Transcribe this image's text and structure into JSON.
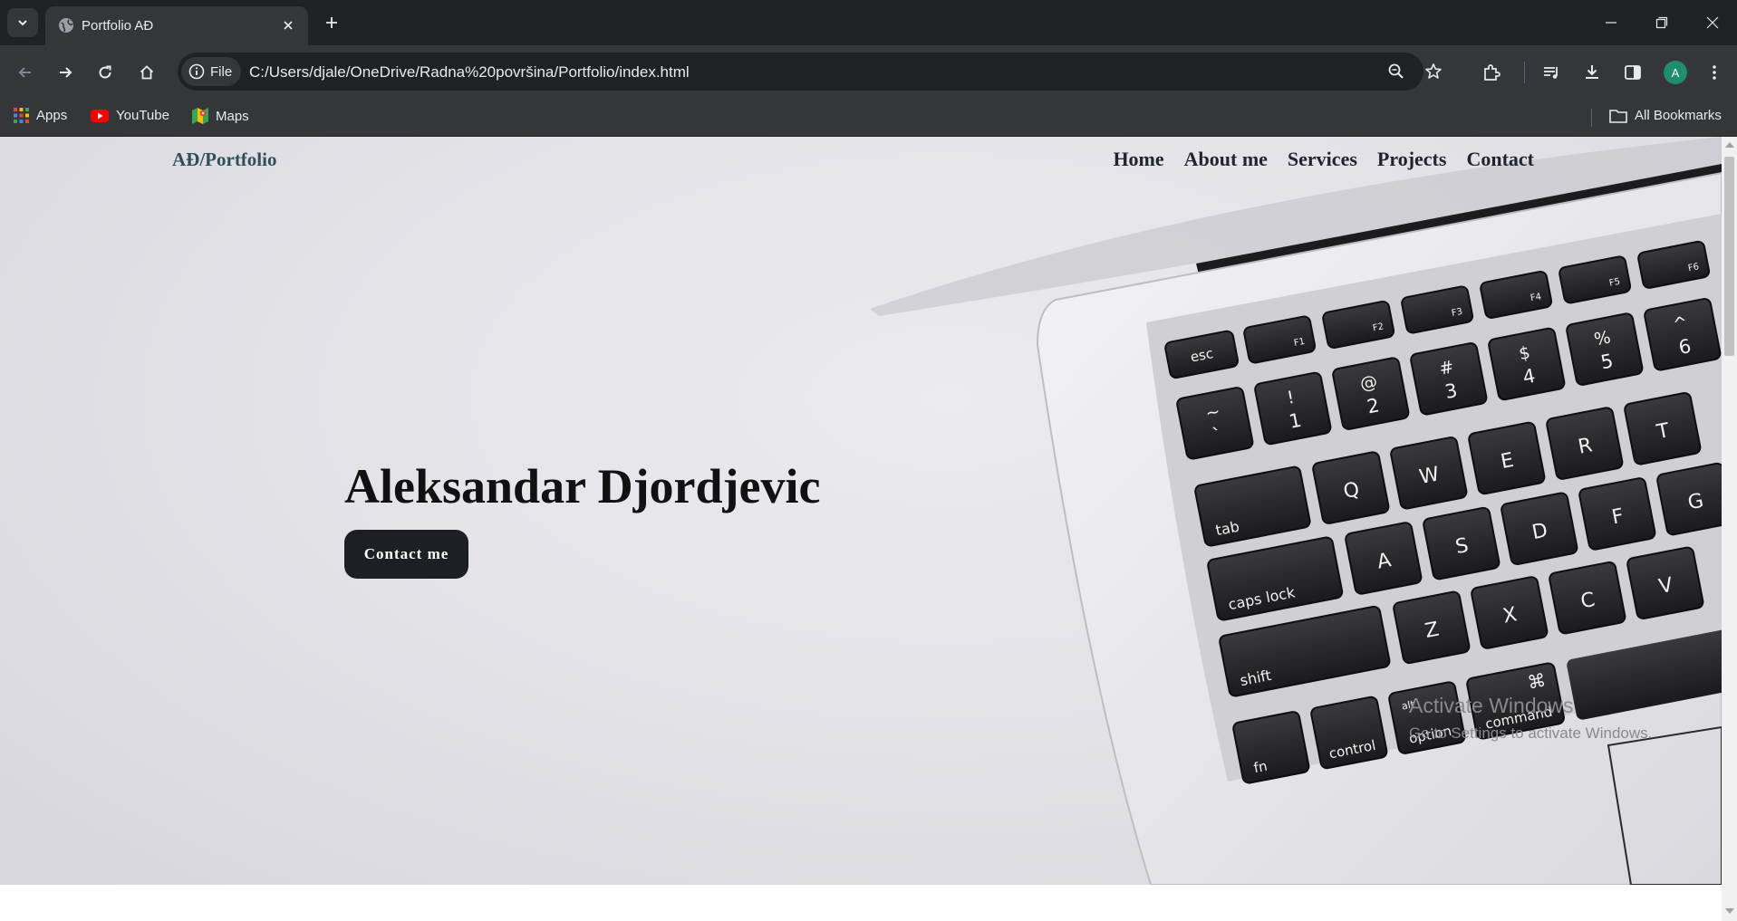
{
  "browser": {
    "tab": {
      "title": "Portfolio AĐ",
      "favicon": "globe-icon"
    },
    "address": {
      "chip_label": "File",
      "url": "C:/Users/djale/OneDrive/Radna%20površina/Portfolio/index.html"
    },
    "avatar_letter": "A",
    "bookmarks": [
      {
        "label": "Apps",
        "icon": "apps-grid-icon"
      },
      {
        "label": "YouTube",
        "icon": "youtube-icon"
      },
      {
        "label": "Maps",
        "icon": "maps-icon"
      }
    ],
    "all_bookmarks_label": "All Bookmarks"
  },
  "page": {
    "brand": "AĐ/Portfolio",
    "nav": [
      "Home",
      "About me",
      "Services",
      "Projects",
      "Contact"
    ],
    "hero_name": "Aleksandar Djordjevic",
    "cta_label": "Contact me",
    "keyboard_keys": {
      "row_fn": [
        "esc",
        "F1",
        "F2",
        "F3",
        "F4",
        "F5",
        "F6"
      ],
      "row_num": [
        [
          "~",
          "`"
        ],
        [
          "!",
          "1"
        ],
        [
          "@",
          "2"
        ],
        [
          "#",
          "3"
        ],
        [
          "$",
          "4"
        ],
        [
          "%",
          "5"
        ],
        [
          "^",
          "6"
        ]
      ],
      "row_q": [
        "tab",
        "Q",
        "W",
        "E",
        "R",
        "T"
      ],
      "row_a": [
        "caps lock",
        "A",
        "S",
        "D",
        "F",
        "G"
      ],
      "row_z": [
        "shift",
        "Z",
        "X",
        "C",
        "V"
      ],
      "row_mod": [
        "fn",
        "control",
        "alt",
        "option",
        "⌘",
        "command"
      ]
    }
  },
  "watermark": {
    "title": "Activate Windows",
    "subtitle": "Go to Settings to activate Windows."
  }
}
